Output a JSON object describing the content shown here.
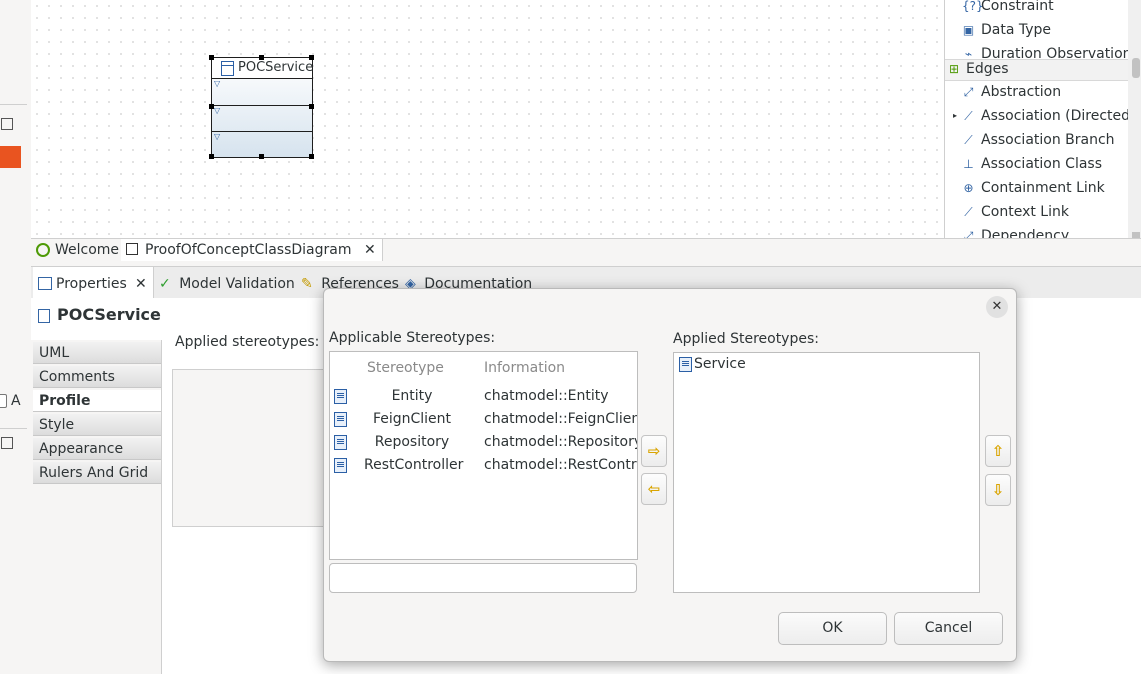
{
  "diagram": {
    "class_name": "POCService"
  },
  "palette": {
    "nodes": [
      "Constraint",
      "Data Type",
      "Duration Observation"
    ],
    "edges_header": "Edges",
    "edges": [
      "Abstraction",
      "Association (Directed)",
      "Association Branch",
      "Association Class",
      "Containment Link",
      "Context Link",
      "Dependency"
    ]
  },
  "editor_tabs": [
    {
      "label": "Welcome"
    },
    {
      "label": "ProofOfConceptClassDiagram"
    }
  ],
  "properties": {
    "tabs": [
      "Properties",
      "Model Validation",
      "References",
      "Documentation"
    ],
    "element_title": "POCService",
    "side_tabs": [
      "UML",
      "Comments",
      "Profile",
      "Style",
      "Appearance",
      "Rulers And Grid"
    ],
    "active_side_tab": "Profile",
    "applied_stereotypes_label": "Applied stereotypes:"
  },
  "dialog": {
    "applicable_label": "Applicable Stereotypes:",
    "applied_label": "Applied Stereotypes:",
    "columns": [
      "Stereotype",
      "Information"
    ],
    "applicable": [
      {
        "stereotype": "Entity",
        "information": "chatmodel::Entity"
      },
      {
        "stereotype": "FeignClient",
        "information": "chatmodel::FeignClient"
      },
      {
        "stereotype": "Repository",
        "information": "chatmodel::Repository"
      },
      {
        "stereotype": "RestController",
        "information": "chatmodel::RestController"
      }
    ],
    "applied": [
      "Service"
    ],
    "filter_value": "",
    "ok_label": "OK",
    "cancel_label": "Cancel"
  },
  "left_strip": {
    "checkbox_label": "A"
  }
}
